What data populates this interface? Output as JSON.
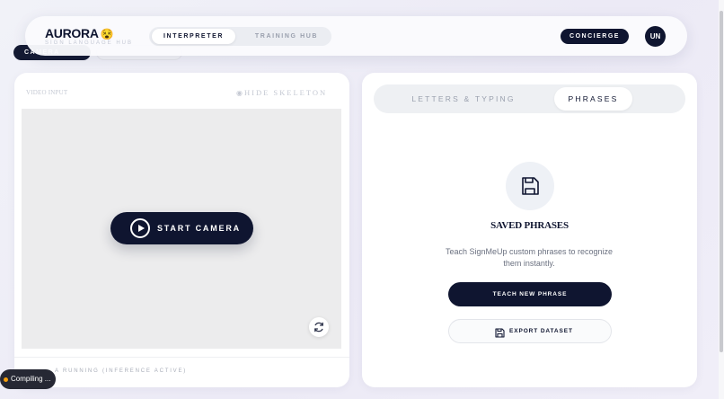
{
  "background": {
    "pill_dark_label": "CAMERA",
    "pill_light_label": ""
  },
  "header": {
    "logo": "AURORA",
    "logo_emoji": "😵",
    "subtitle": "SIGN LANGUAGE HUB",
    "nav_tabs": [
      {
        "label": "INTERPRETER",
        "active": true
      },
      {
        "label": "TRAINING HUB",
        "active": false
      }
    ],
    "concierge_label": "CONCIERGE",
    "avatar_initials": "UN"
  },
  "video_panel": {
    "label": "VIDEO INPUT",
    "hide_skeleton_label": "HIDE SKELETON",
    "start_camera_label": "START CAMERA",
    "status_text": "A RUNNING (INFERENCE ACTIVE)"
  },
  "phrases_panel": {
    "tabs": [
      {
        "label": "LETTERS & TYPING",
        "active": false
      },
      {
        "label": "PHRASES",
        "active": true
      }
    ],
    "title": "SAVED PHRASES",
    "description": "Teach SignMeUp custom phrases to recognize them instantly.",
    "teach_button_label": "TEACH NEW PHRASE",
    "export_button_label": "EXPORT DATASET"
  },
  "toast": {
    "label": "Compiling ..."
  },
  "colors": {
    "accent_dark": "#0f1530",
    "toast_dot": "#f59e0b"
  }
}
